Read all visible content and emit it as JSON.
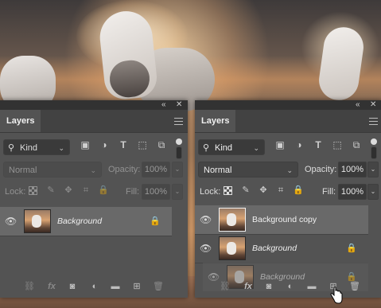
{
  "panel_left": {
    "tab_label": "Layers",
    "collapse_glyph": "«",
    "close_glyph": "✕",
    "filter": {
      "label": "Kind",
      "search_icon": "search-icon"
    },
    "blend_mode": "Normal",
    "opacity_label": "Opacity:",
    "opacity_value": "100%",
    "lock_label": "Lock:",
    "fill_label": "Fill:",
    "fill_value": "100%",
    "layers": [
      {
        "name": "Background",
        "locked": true,
        "selected": true,
        "visible": true
      }
    ]
  },
  "panel_right": {
    "tab_label": "Layers",
    "collapse_glyph": "«",
    "close_glyph": "✕",
    "filter": {
      "label": "Kind",
      "search_icon": "search-icon"
    },
    "blend_mode": "Normal",
    "opacity_label": "Opacity:",
    "opacity_value": "100%",
    "lock_label": "Lock:",
    "fill_label": "Fill:",
    "fill_value": "100%",
    "layers": [
      {
        "name": "Background copy",
        "locked": false,
        "selected": true,
        "visible": true
      },
      {
        "name": "Background",
        "locked": true,
        "selected": false,
        "visible": true
      },
      {
        "name": "Background",
        "locked": true,
        "selected": false,
        "visible": true,
        "dragging": true
      }
    ]
  },
  "bottom_icons": [
    "link-icon",
    "fx-icon",
    "mask-icon",
    "adjustment-icon",
    "folder-icon",
    "new-layer-icon",
    "trash-icon"
  ],
  "bottom_glyphs": {
    "link": "⛓",
    "fx": "fx",
    "mask": "◙",
    "adjust": "◐",
    "folder": "▬",
    "new": "⊞",
    "trash": "🗑"
  },
  "filter_glyphs": {
    "image": "▣",
    "adjust": "◑",
    "type": "T",
    "shape": "⬚",
    "smart": "⧉"
  },
  "lock_glyphs": {
    "brush": "✎",
    "move": "✥",
    "artboard": "⌗",
    "lock": "🔒"
  },
  "eye_glyph": "👁",
  "colors": {
    "panel": "#535353",
    "selected_row": "#696969",
    "tab_bar": "#424242",
    "title_bar": "#323232"
  }
}
